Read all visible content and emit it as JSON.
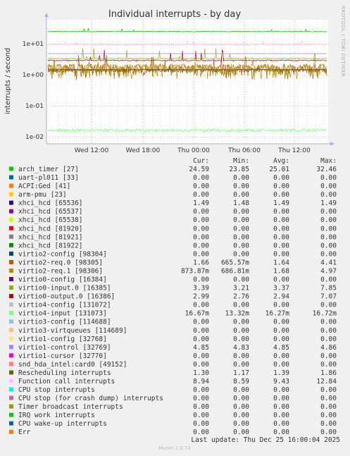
{
  "chart_data": {
    "type": "line",
    "title": "Individual interrupts - by day",
    "ylabel": "interrupts / second",
    "yscale": "log",
    "ylim": [
      0.006,
      60
    ],
    "y_ticks": [
      {
        "value": 0.01,
        "label": "1e-02"
      },
      {
        "value": 0.1,
        "label": "1e-01"
      },
      {
        "value": 1,
        "label": "1e+00"
      },
      {
        "value": 10,
        "label": "1e+01"
      }
    ],
    "x_ticks": [
      "Wed 12:00",
      "Wed 18:00",
      "Thu 00:00",
      "Thu 06:00",
      "Thu 12:00"
    ],
    "side_label": "RRDTOOL / TOBI OETIKER",
    "columns": [
      "Cur:",
      "Min:",
      "Avg:",
      "Max:"
    ],
    "grid": true,
    "series": [
      {
        "name": "arch_timer [27]",
        "color": "#00cc00",
        "cur": "24.59",
        "min": "23.85",
        "avg": "25.01",
        "max": "32.46"
      },
      {
        "name": "uart-pl011 [33]",
        "color": "#0066b3",
        "cur": "0.00",
        "min": "0.00",
        "avg": "0.00",
        "max": "0.00"
      },
      {
        "name": "ACPI:Ged [41]",
        "color": "#ff8000",
        "cur": "0.00",
        "min": "0.00",
        "avg": "0.00",
        "max": "0.00"
      },
      {
        "name": "arm-pmu [23]",
        "color": "#ffcc00",
        "cur": "0.00",
        "min": "0.00",
        "avg": "0.00",
        "max": "0.00"
      },
      {
        "name": "xhci_hcd [65536]",
        "color": "#330099",
        "cur": "1.49",
        "min": "1.48",
        "avg": "1.49",
        "max": "1.49"
      },
      {
        "name": "xhci_hcd [65537]",
        "color": "#990099",
        "cur": "0.00",
        "min": "0.00",
        "avg": "0.00",
        "max": "0.00"
      },
      {
        "name": "xhci_hcd [65538]",
        "color": "#ccff00",
        "cur": "0.00",
        "min": "0.00",
        "avg": "0.00",
        "max": "0.00"
      },
      {
        "name": "xhci_hcd [81920]",
        "color": "#ff0000",
        "cur": "0.00",
        "min": "0.00",
        "avg": "0.00",
        "max": "0.00"
      },
      {
        "name": "xhci_hcd [81921]",
        "color": "#808080",
        "cur": "0.00",
        "min": "0.00",
        "avg": "0.00",
        "max": "0.00"
      },
      {
        "name": "xhci_hcd [81922]",
        "color": "#008f00",
        "cur": "0.00",
        "min": "0.00",
        "avg": "0.00",
        "max": "0.00"
      },
      {
        "name": "virtio2-config [98304]",
        "color": "#00487d",
        "cur": "0.00",
        "min": "0.00",
        "avg": "0.00",
        "max": "0.00"
      },
      {
        "name": "virtio2-req.0 [98305]",
        "color": "#b35a00",
        "cur": "1.66",
        "min": "665.57m",
        "avg": "1.64",
        "max": "4.41"
      },
      {
        "name": "virtio2-req.1 [98306]",
        "color": "#b38f00",
        "cur": "873.87m",
        "min": "686.81m",
        "avg": "1.68",
        "max": "4.97"
      },
      {
        "name": "virtio0-config [16384]",
        "color": "#6b006b",
        "cur": "0.00",
        "min": "0.00",
        "avg": "0.00",
        "max": "0.00"
      },
      {
        "name": "virtio0-input.0 [16385]",
        "color": "#8fb300",
        "cur": "3.39",
        "min": "3.21",
        "avg": "3.37",
        "max": "7.85"
      },
      {
        "name": "virtio0-output.0 [16386]",
        "color": "#b30000",
        "cur": "2.99",
        "min": "2.76",
        "avg": "2.94",
        "max": "7.07"
      },
      {
        "name": "virtio4-config [131072]",
        "color": "#bebebe",
        "cur": "0.00",
        "min": "0.00",
        "avg": "0.00",
        "max": "0.00"
      },
      {
        "name": "virtio4-input [131073]",
        "color": "#80ff80",
        "cur": "16.67m",
        "min": "13.32m",
        "avg": "16.27m",
        "max": "16.72m"
      },
      {
        "name": "virtio3-config [114688]",
        "color": "#80c9ff",
        "cur": "0.00",
        "min": "0.00",
        "avg": "0.00",
        "max": "0.00"
      },
      {
        "name": "virtio3-virtqueues [114689]",
        "color": "#ffc080",
        "cur": "0.00",
        "min": "0.00",
        "avg": "0.00",
        "max": "0.00"
      },
      {
        "name": "virtio1-config [32768]",
        "color": "#ffe680",
        "cur": "0.00",
        "min": "0.00",
        "avg": "0.00",
        "max": "0.00"
      },
      {
        "name": "virtio1-control [32769]",
        "color": "#aa80ff",
        "cur": "4.85",
        "min": "4.83",
        "avg": "4.85",
        "max": "4.86"
      },
      {
        "name": "virtio1-cursor [32770]",
        "color": "#ee00cc",
        "cur": "0.00",
        "min": "0.00",
        "avg": "0.00",
        "max": "0.00"
      },
      {
        "name": "snd_hda_intel:card0 [49152]",
        "color": "#ff8080",
        "cur": "0.00",
        "min": "0.00",
        "avg": "0.00",
        "max": "0.00"
      },
      {
        "name": "Rescheduling interrupts",
        "color": "#666600",
        "cur": "1.30",
        "min": "1.17",
        "avg": "1.39",
        "max": "1.86"
      },
      {
        "name": "Function call interrupts",
        "color": "#ffbfff",
        "cur": "8.94",
        "min": "8.59",
        "avg": "9.43",
        "max": "12.84"
      },
      {
        "name": "CPU stop interrupts",
        "color": "#00ffcc",
        "cur": "0.00",
        "min": "0.00",
        "avg": "0.00",
        "max": "0.00"
      },
      {
        "name": "CPU stop (for crash dump) interrupts",
        "color": "#cc6699",
        "cur": "0.00",
        "min": "0.00",
        "avg": "0.00",
        "max": "0.00"
      },
      {
        "name": "Timer broadcast interrupts",
        "color": "#999900",
        "cur": "0.00",
        "min": "0.00",
        "avg": "0.00",
        "max": "0.00"
      },
      {
        "name": "IRQ work interrupts",
        "color": "#00cc00",
        "cur": "0.00",
        "min": "0.00",
        "avg": "0.00",
        "max": "0.00"
      },
      {
        "name": "CPU wake-up interrupts",
        "color": "#0066b3",
        "cur": "0.00",
        "min": "0.00",
        "avg": "0.00",
        "max": "0.00"
      },
      {
        "name": "Err",
        "color": "#ff8000",
        "cur": "0.00",
        "min": "0.00",
        "avg": "0.00",
        "max": "0.00"
      }
    ]
  },
  "footer": {
    "last_update": "Last update: Thu Dec 25 16:00:04 2025",
    "version": "Munin 2.0.73"
  }
}
